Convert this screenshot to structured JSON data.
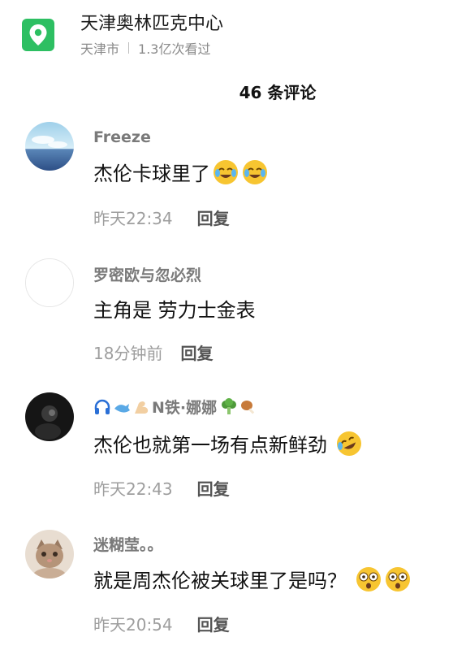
{
  "location": {
    "title": "天津奥林匹克中心",
    "city": "天津市",
    "views": "1.3亿次看过",
    "icon": "location-pin-icon",
    "accent": "#2dbf62"
  },
  "comments_header": {
    "count_label": "46 条评论"
  },
  "comments": [
    {
      "name": "Freeze",
      "text": "杰伦卡球里了",
      "time": "昨天22:34",
      "reply": "回复",
      "emojis": [
        "crying-laugh-emoji",
        "crying-laugh-emoji"
      ]
    },
    {
      "name": "罗密欧与忽必烈",
      "text": "主角是 劳力士金表",
      "time": "18分钟前",
      "reply": "回复",
      "emojis": []
    },
    {
      "name": "N铁·娜娜",
      "name_icons": [
        "headphones-icon",
        "whale-icon",
        "flexed-arm-icon"
      ],
      "name_icons_after": [
        "broccoli-icon",
        "drumstick-icon"
      ],
      "text": "杰伦也就第一场有点新鲜劲",
      "time": "昨天22:43",
      "reply": "回复",
      "emojis": [
        "rolling-laugh-emoji"
      ]
    },
    {
      "name": "迷糊莹。。",
      "text": "就是周杰伦被关球里了是吗？",
      "time": "昨天20:54",
      "reply": "回复",
      "emojis": [
        "shocked-face-emoji",
        "shocked-face-emoji"
      ]
    }
  ]
}
